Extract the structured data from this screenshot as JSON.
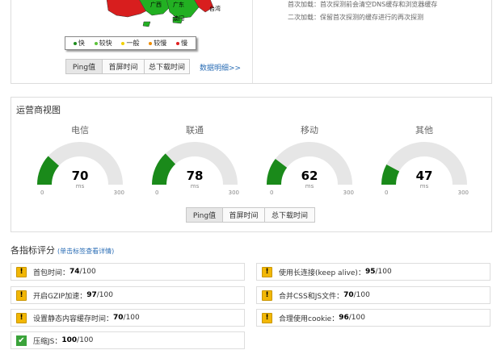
{
  "top": {
    "map_labels": [
      "广西",
      "广东",
      "台湾",
      "澳门"
    ],
    "legend": [
      {
        "label": "快",
        "color": "#1e8c1e"
      },
      {
        "label": "较快",
        "color": "#5cc23a"
      },
      {
        "label": "一般",
        "color": "#f0d000"
      },
      {
        "label": "较慢",
        "color": "#f08c00"
      },
      {
        "label": "慢",
        "color": "#e02020"
      }
    ],
    "buttons": [
      "Ping值",
      "首屏时间",
      "总下载时间"
    ],
    "detail_link": "数据明细>>",
    "desc_first": "首次加载：首次探测前会清空DNS缓存和浏览器缓存",
    "desc_second": "二次加载：保留首次探测的缓存进行的再次探测"
  },
  "carriers": {
    "title": "运营商视图",
    "gauges": [
      {
        "name": "电信",
        "value": 70
      },
      {
        "name": "联通",
        "value": 78
      },
      {
        "name": "移动",
        "value": 62
      },
      {
        "name": "其他",
        "value": 47
      }
    ],
    "unit": "ms",
    "min_label": "0",
    "max_label": "300",
    "max": 300,
    "fill_color": "#1a8a1a",
    "track_color": "#e6e6e6",
    "buttons": [
      "Ping值",
      "首屏时间",
      "总下载时间"
    ]
  },
  "scores": {
    "title": "各指标评分",
    "link": "(单击标签查看详情)",
    "max_suffix": "/100",
    "items": [
      {
        "name": "首包时间：",
        "value": "74",
        "icon": "warning-icon"
      },
      {
        "name": "使用长连接(keep alive)：",
        "value": "95",
        "icon": "warning-icon"
      },
      {
        "name": "开启GZIP加速：",
        "value": "97",
        "icon": "warning-icon"
      },
      {
        "name": "合并CSS和JS文件：",
        "value": "70",
        "icon": "warning-icon"
      },
      {
        "name": "设置静态内容缓存时间：",
        "value": "70",
        "icon": "warning-icon"
      },
      {
        "name": "合理使用cookie：",
        "value": "96",
        "icon": "warning-icon"
      },
      {
        "name": "压缩JS：",
        "value": "100",
        "icon": "check-icon"
      }
    ]
  }
}
